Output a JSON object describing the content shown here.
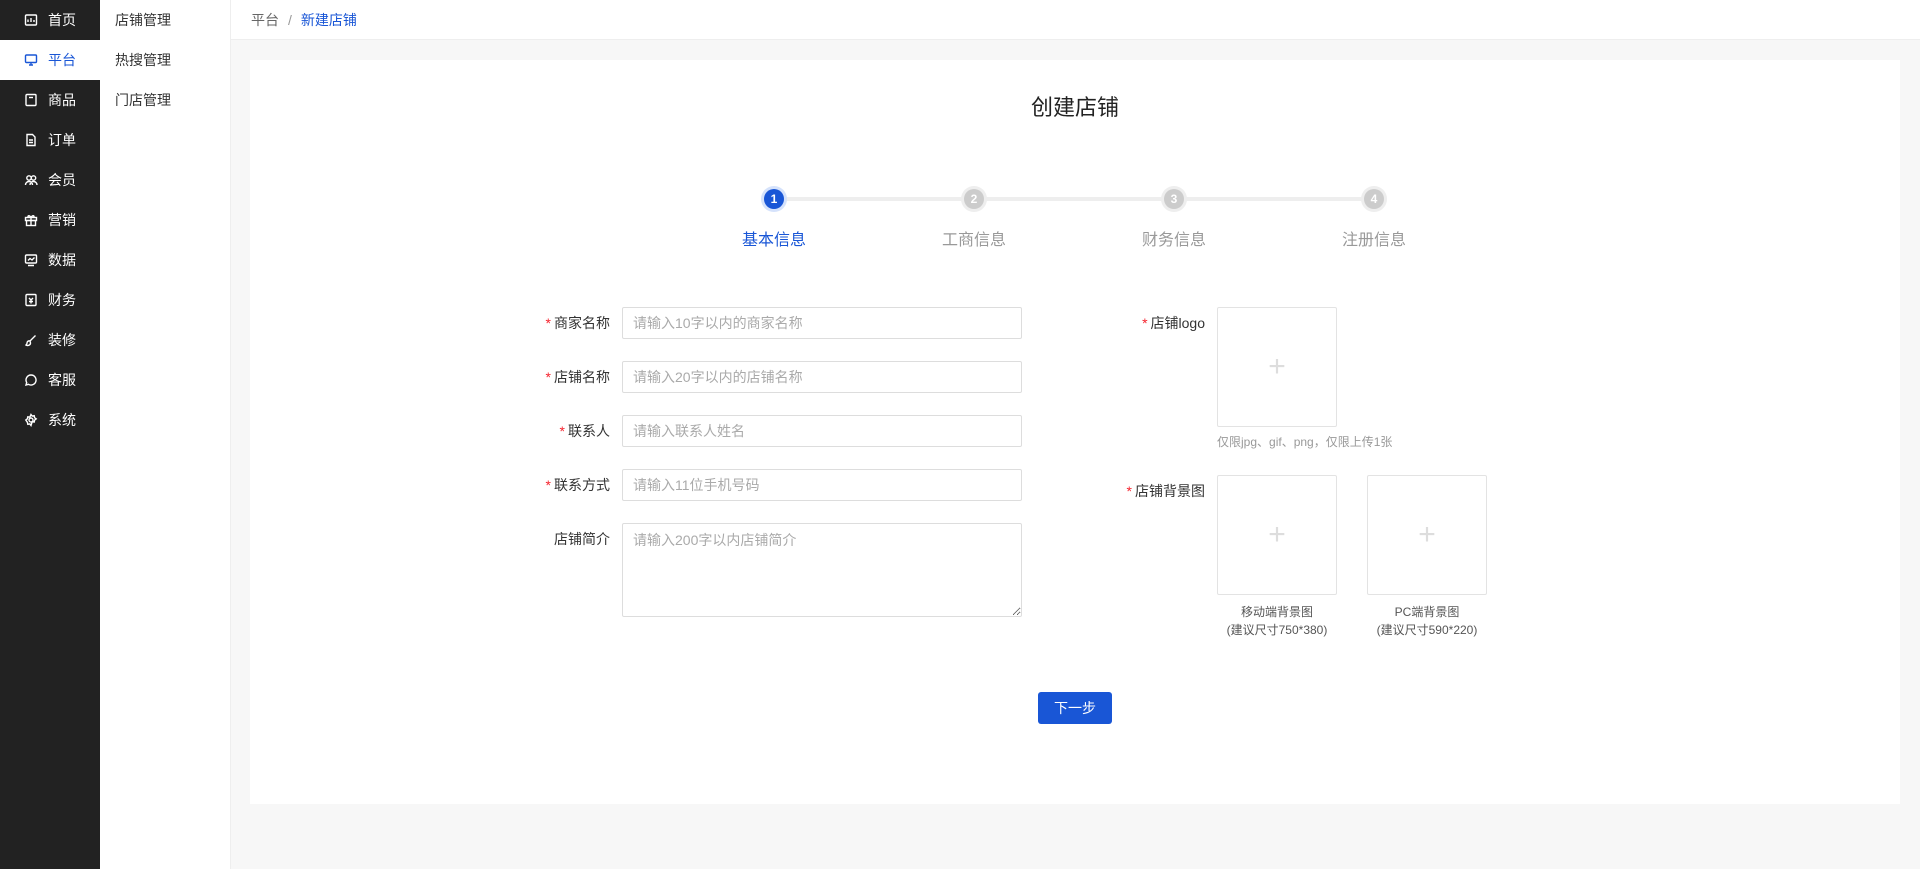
{
  "sidebar": {
    "items": [
      {
        "label": "首页",
        "icon": "dashboard-icon"
      },
      {
        "label": "平台",
        "icon": "monitor-icon"
      },
      {
        "label": "商品",
        "icon": "box-icon"
      },
      {
        "label": "订单",
        "icon": "document-icon"
      },
      {
        "label": "会员",
        "icon": "users-icon"
      },
      {
        "label": "营销",
        "icon": "gift-icon"
      },
      {
        "label": "数据",
        "icon": "chart-icon"
      },
      {
        "label": "财务",
        "icon": "finance-icon"
      },
      {
        "label": "装修",
        "icon": "brush-icon"
      },
      {
        "label": "客服",
        "icon": "chat-icon"
      },
      {
        "label": "系统",
        "icon": "gear-icon"
      }
    ],
    "active_index": 1
  },
  "submenu": {
    "items": [
      "店铺管理",
      "热搜管理",
      "门店管理"
    ]
  },
  "breadcrumb": {
    "items": [
      "平台",
      "新建店铺"
    ],
    "separator": "/"
  },
  "page": {
    "title": "创建店铺"
  },
  "steps": {
    "items": [
      {
        "number": "1",
        "label": "基本信息"
      },
      {
        "number": "2",
        "label": "工商信息"
      },
      {
        "number": "3",
        "label": "财务信息"
      },
      {
        "number": "4",
        "label": "注册信息"
      }
    ],
    "current": 1
  },
  "form": {
    "merchant_name": {
      "label": "商家名称",
      "placeholder": "请输入10字以内的商家名称",
      "required": true
    },
    "store_name": {
      "label": "店铺名称",
      "placeholder": "请输入20字以内的店铺名称",
      "required": true
    },
    "contact": {
      "label": "联系人",
      "placeholder": "请输入联系人姓名",
      "required": true
    },
    "phone": {
      "label": "联系方式",
      "placeholder": "请输入11位手机号码",
      "required": true
    },
    "intro": {
      "label": "店铺简介",
      "placeholder": "请输入200字以内店铺简介",
      "required": false
    },
    "logo": {
      "label": "店铺logo",
      "tip": "仅限jpg、gif、png，仅限上传1张",
      "required": true
    },
    "background": {
      "label": "店铺背景图",
      "required": true,
      "mobile_caption": "移动端背景图",
      "mobile_size": "(建议尺寸750*380)",
      "pc_caption": "PC端背景图",
      "pc_size": "(建议尺寸590*220)"
    },
    "required_mark": "*",
    "upload_symbol": "+"
  },
  "actions": {
    "next_label": "下一步"
  },
  "colors": {
    "primary": "#1956d6",
    "sidebar_bg": "#222222",
    "required": "#f5222d"
  }
}
